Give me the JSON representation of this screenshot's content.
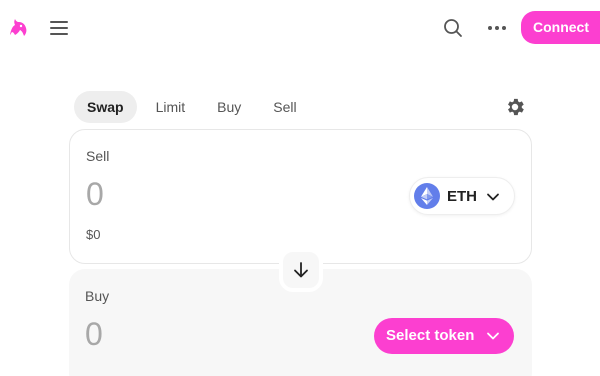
{
  "header": {
    "logo_icon": "uniswap-unicorn-icon",
    "menu_icon": "hamburger-menu-icon",
    "search_icon": "search-icon",
    "more_icon": "more-dots-icon",
    "connect_label": "Connect"
  },
  "tabs": [
    {
      "label": "Swap",
      "active": true
    },
    {
      "label": "Limit",
      "active": false
    },
    {
      "label": "Buy",
      "active": false
    },
    {
      "label": "Sell",
      "active": false
    }
  ],
  "settings_icon": "gear-icon",
  "sell": {
    "label": "Sell",
    "amount": "0",
    "usd_value": "$0",
    "token": {
      "symbol": "ETH",
      "icon": "ethereum-icon"
    }
  },
  "swap_direction_icon": "arrow-down-icon",
  "buy": {
    "label": "Buy",
    "amount": "0",
    "select_token_label": "Select token"
  },
  "colors": {
    "accent": "#fc3fd0",
    "eth_blue": "#627eea",
    "panel_border": "#e7e7e7",
    "buy_panel_bg": "#f7f7f7"
  }
}
